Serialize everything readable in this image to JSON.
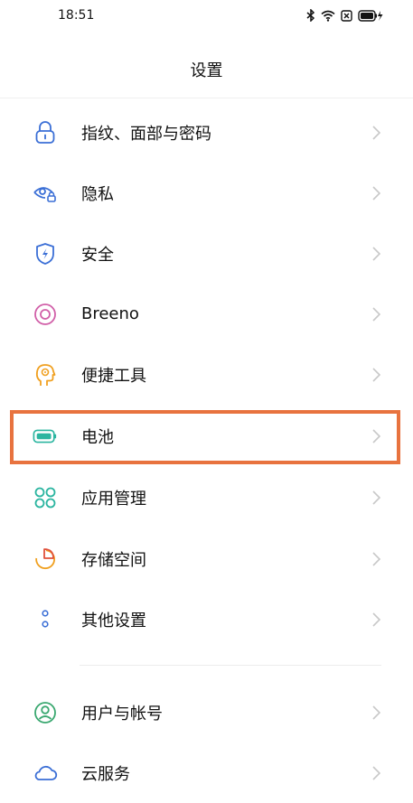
{
  "status_bar": {
    "time": "18:51",
    "icons": [
      "bluetooth-icon",
      "wifi-icon",
      "sim-x-icon",
      "battery-charging-icon"
    ]
  },
  "header": {
    "title": "设置"
  },
  "items": [
    {
      "label": "指纹、面部与密码",
      "icon": "lock-icon",
      "color": "#3b6fd6"
    },
    {
      "label": "隐私",
      "icon": "privacy-eye-icon",
      "color": "#3b6fd6"
    },
    {
      "label": "安全",
      "icon": "shield-icon",
      "color": "#3b6fd6"
    },
    {
      "label": "Breeno",
      "icon": "breeno-icon",
      "color": "#d15fa8"
    },
    {
      "label": "便捷工具",
      "icon": "tools-head-icon",
      "color": "#f0a020"
    },
    {
      "label": "电池",
      "icon": "battery-icon",
      "color": "#2bb5a0"
    },
    {
      "label": "应用管理",
      "icon": "apps-icon",
      "color": "#2bb5a0"
    },
    {
      "label": "存储空间",
      "icon": "storage-pie-icon",
      "color": "#f0a020"
    },
    {
      "label": "其他设置",
      "icon": "more-dots-icon",
      "color": "#3b6fd6"
    },
    {
      "label": "用户与帐号",
      "icon": "user-icon",
      "color": "#3aa870"
    },
    {
      "label": "云服务",
      "icon": "cloud-icon",
      "color": "#3b6fd6"
    }
  ],
  "highlight_color": "#e8733f"
}
